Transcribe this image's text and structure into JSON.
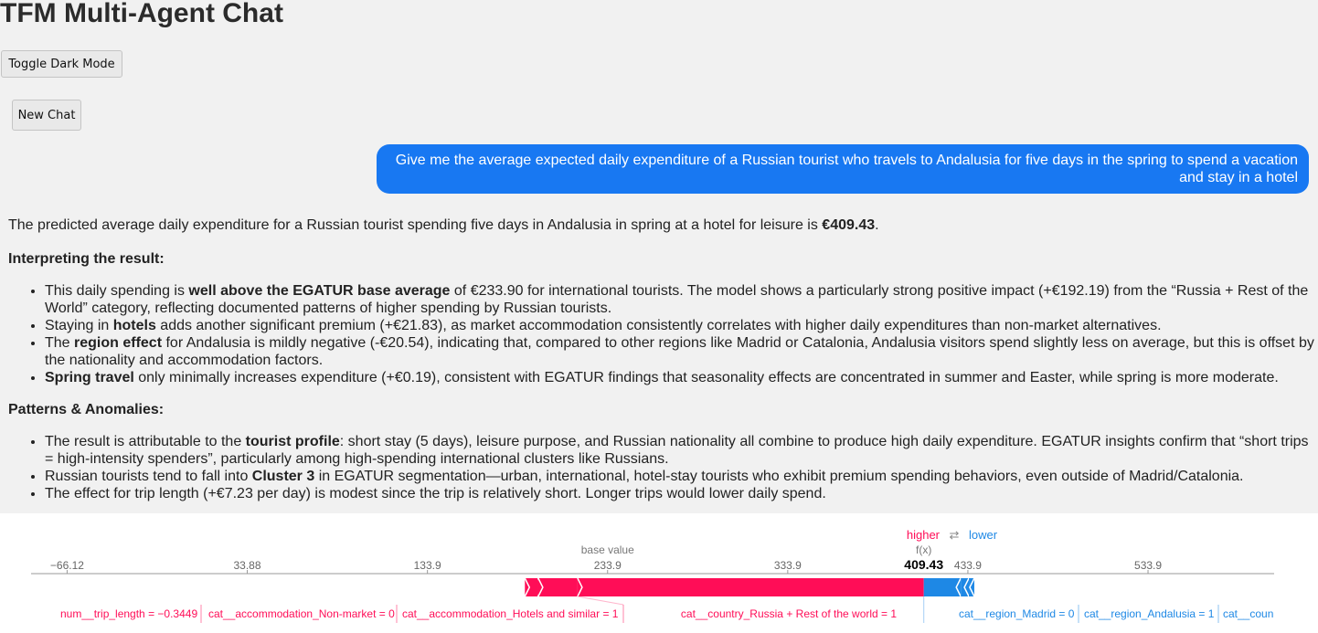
{
  "app": {
    "title": "TFM Multi-Agent Chat",
    "toggle_label": "Toggle Dark Mode",
    "new_chat_label": "New Chat"
  },
  "chat": {
    "user_message_line1": "Give me the average expected daily expenditure of a Russian tourist who travels to Andalusia for five days in the spring to spend a vacation",
    "user_message_line2": "and stay in a hotel",
    "answer": {
      "intro": "The predicted average daily expenditure for a Russian tourist spending five days in Andalusia in spring at a hotel for leisure is ",
      "intro_value": "€409.43",
      "intro_end": ".",
      "heading1": "Interpreting the result:",
      "list1": [
        {
          "pre": "This daily spending is ",
          "bold": "well above the EGATUR base average",
          "post": " of €233.90 for international tourists. The model shows a particularly strong positive impact (+€192.19) from the “Russia + Rest of the World” category, reflecting documented patterns of higher spending by Russian tourists."
        },
        {
          "pre": "Staying in ",
          "bold": "hotels",
          "post": " adds another significant premium (+€21.83), as market accommodation consistently correlates with higher daily expenditures than non-market alternatives."
        },
        {
          "pre": "The ",
          "bold": "region effect",
          "post": " for Andalusia is mildly negative (-€20.54), indicating that, compared to other regions like Madrid or Catalonia, Andalusia visitors spend slightly less on average, but this is offset by the nationality and accommodation factors."
        },
        {
          "pre": "",
          "bold": "Spring travel",
          "post": " only minimally increases expenditure (+€0.19), consistent with EGATUR findings that seasonality effects are concentrated in summer and Easter, while spring is more moderate."
        }
      ],
      "heading2": "Patterns & Anomalies:",
      "list2": [
        {
          "pre": "The result is attributable to the ",
          "bold": "tourist profile",
          "post": ": short stay (5 days), leisure purpose, and Russian nationality all combine to produce high daily expenditure. EGATUR insights confirm that “short trips = high-intensity spenders”, particularly among high-spending international clusters like Russians."
        },
        {
          "pre": "Russian tourists tend to fall into ",
          "bold": "Cluster 3",
          "post": " in EGATUR segmentation—urban, international, hotel-stay tourists who exhibit premium spending behaviors, even outside of Madrid/Catalonia."
        },
        {
          "pre": "The effect for trip length (+€7.23 per day) is modest since the trip is relatively short. Longer trips would lower daily spend.",
          "bold": "",
          "post": ""
        }
      ]
    }
  },
  "chart_data": {
    "type": "force",
    "legend_higher": "higher",
    "legend_arrows": "⇄",
    "legend_lower": "lower",
    "legend_placement": "top",
    "base_label": "base value",
    "fx_label": "f(x)",
    "base_value": 233.9,
    "fx_value": 409.43,
    "fx_text": "409.43",
    "colors": {
      "higher": "#ff0d57",
      "lower": "#1e88e5",
      "axis": "#777777",
      "text": "#555555"
    },
    "axis": {
      "min": -86.12,
      "max": 603.9,
      "ticks": [
        -66.12,
        33.88,
        133.9,
        233.9,
        333.9,
        433.9,
        533.9
      ],
      "tick_labels": [
        "−66.12",
        "33.88",
        "133.9",
        "233.9",
        "333.9",
        "433.9",
        "533.9"
      ]
    },
    "features": [
      {
        "label": "num__trip_length = −0.3449",
        "effect": 7.23,
        "dir": "higher"
      },
      {
        "label": "cat__accommodation_Non-market = 0",
        "effect": 0.19,
        "dir": "higher"
      },
      {
        "label": "cat__accommodation_Hotels and similar = 1",
        "effect": 21.83,
        "dir": "higher"
      },
      {
        "label": "cat__country_Russia + Rest of the world = 1",
        "effect": 192.19,
        "dir": "higher"
      },
      {
        "label": "cat__region_Madrid = 0",
        "effect": -20.54,
        "dir": "lower"
      },
      {
        "label": "cat__region_Andalusia = 1",
        "effect": -4.5,
        "dir": "lower"
      },
      {
        "label": "cat__coun",
        "effect": -3.0,
        "dir": "lower"
      }
    ]
  }
}
